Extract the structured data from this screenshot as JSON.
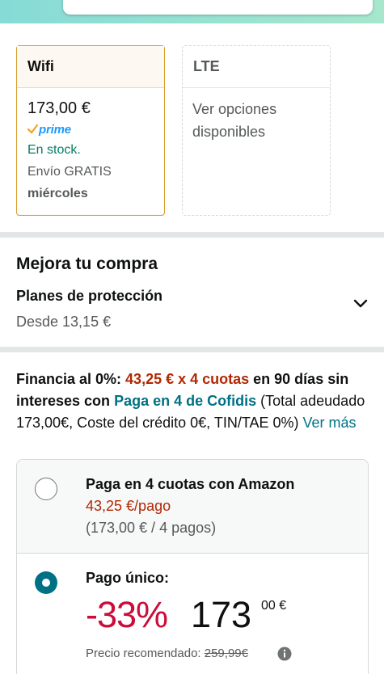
{
  "header": {
    "search_icon": "search-icon",
    "camera_icon": "camera-icon",
    "colors": {
      "band_start": "#86dbd6",
      "band_end": "#a6e7ce"
    }
  },
  "variants": [
    {
      "title": "Wifi",
      "price": "173,00 €",
      "prime": "prime",
      "stock": "En stock.",
      "shipping": "Envío GRATIS",
      "delivery_day": "miércoles",
      "selected": true
    },
    {
      "title": "LTE",
      "options_text": "Ver opciones disponibles",
      "selected": false
    }
  ],
  "upsell": {
    "title": "Mejora tu compra",
    "protection_label": "Planes de protección",
    "protection_price": "Desde 13,15 €"
  },
  "financing": {
    "prefix": "Financia al 0%: ",
    "installments": "43,25 € x 4 cuotas",
    "middle": " en 90 días sin intereses con ",
    "provider": "Paga en 4 de Cofidis",
    "suffix": " (Total adeudado 173,00€, Coste del crédito 0€, TIN/TAE 0%) ",
    "link": "Ver más"
  },
  "payment_options": {
    "option1": {
      "title": "Paga en 4 cuotas con Amazon",
      "price": "43,25 €/pago",
      "detail": "(173,00 € / 4 pagos)",
      "selected": false
    },
    "option2": {
      "title": "Pago único:",
      "discount": "-33%",
      "price_whole": "173",
      "price_cents": "00 €",
      "list_price_label": "Precio recomendado: ",
      "list_price": "259,99€",
      "selected": true
    }
  }
}
